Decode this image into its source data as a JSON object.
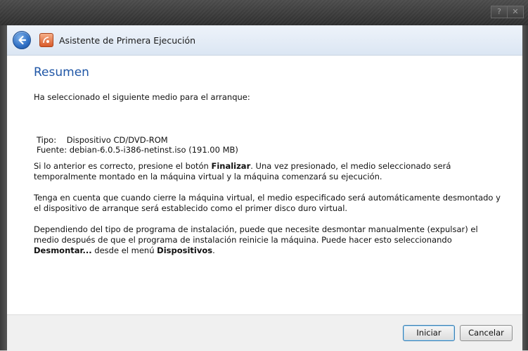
{
  "window": {
    "help_label": "?",
    "close_label": "✕"
  },
  "header": {
    "title": "Asistente de Primera Ejecución",
    "back_icon": "back-arrow-icon",
    "app_icon": "virtualbox-icon"
  },
  "content": {
    "heading": "Resumen",
    "intro": "Ha seleccionado el siguiente medio para el arranque:",
    "media_type_line": "Tipo:    Dispositivo CD/DVD-ROM",
    "media_source_line": "Fuente: debian-6.0.5-i386-netinst.iso (191.00 MB)",
    "p1_a": "Si lo anterior es correcto, presione el botón ",
    "p1_b": "Finalizar",
    "p1_c": ". Una vez presionado, el medio seleccionado será temporalmente montado en la máquina virtual y la máquina comenzará su ejecución.",
    "p2": "Tenga en cuenta que cuando cierre la máquina virtual, el medio especificado será automáticamente desmontado y el dispositivo de arranque será establecido como el primer disco duro virtual.",
    "p3_a": "Dependiendo del tipo de programa de instalación, puede que necesite desmontar manualmente (expulsar) el medio después de que el programa de instalación reinicie la máquina. Puede hacer esto seleccionando ",
    "p3_b": "Desmontar...",
    "p3_c": " desde el menú ",
    "p3_d": "Dispositivos",
    "p3_e": "."
  },
  "footer": {
    "start_label": "Iniciar",
    "cancel_label": "Cancelar"
  },
  "colors": {
    "heading": "#1f56a6",
    "header_bg": "#dbe6f3",
    "titlebar": "#3a3a3a"
  }
}
